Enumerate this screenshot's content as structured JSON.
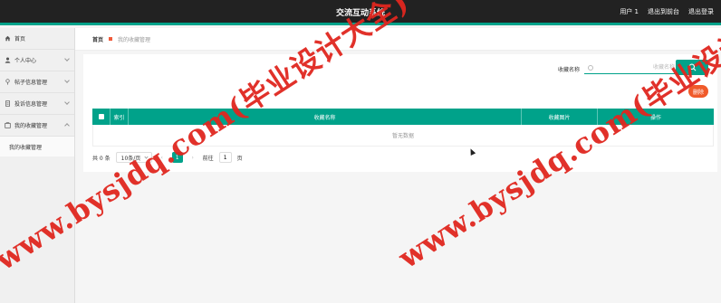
{
  "header": {
    "title": "交流互动系统",
    "user_label": "用户 1",
    "back_frontend": "退出到前台",
    "logout": "退出登录"
  },
  "sidebar": {
    "items": [
      {
        "label": "首页",
        "icon": "home-icon"
      },
      {
        "label": "个人中心",
        "icon": "user-icon"
      },
      {
        "label": "帖子信息管理",
        "icon": "pin-icon"
      },
      {
        "label": "投诉信息管理",
        "icon": "document-icon"
      },
      {
        "label": "我的收藏管理",
        "icon": "collection-icon"
      }
    ],
    "sub_items": [
      {
        "label": "我的收藏管理"
      }
    ]
  },
  "breadcrumb": {
    "home": "首页",
    "current": "我的收藏管理"
  },
  "search": {
    "label": "收藏名称",
    "placeholder": "收藏名称",
    "button_icon": "search-icon"
  },
  "actions": {
    "delete": "删除"
  },
  "table": {
    "headers": [
      "",
      "索引",
      "收藏名称",
      "收藏图片",
      "操作"
    ],
    "empty_text": "暂无数据"
  },
  "pagination": {
    "total": "共 0 条",
    "page_size": "10条/页",
    "prev": "‹",
    "current_page": "1",
    "next": "›",
    "goto_label": "前往",
    "goto_value": "1",
    "page_suffix": "页"
  },
  "watermark": {
    "text": "www.bysjdq.com(毕业设计大全)",
    "color": "#e0271f"
  },
  "colors": {
    "accent": "#00a28a",
    "topbar": "#222222",
    "danger": "#f05a2a"
  }
}
